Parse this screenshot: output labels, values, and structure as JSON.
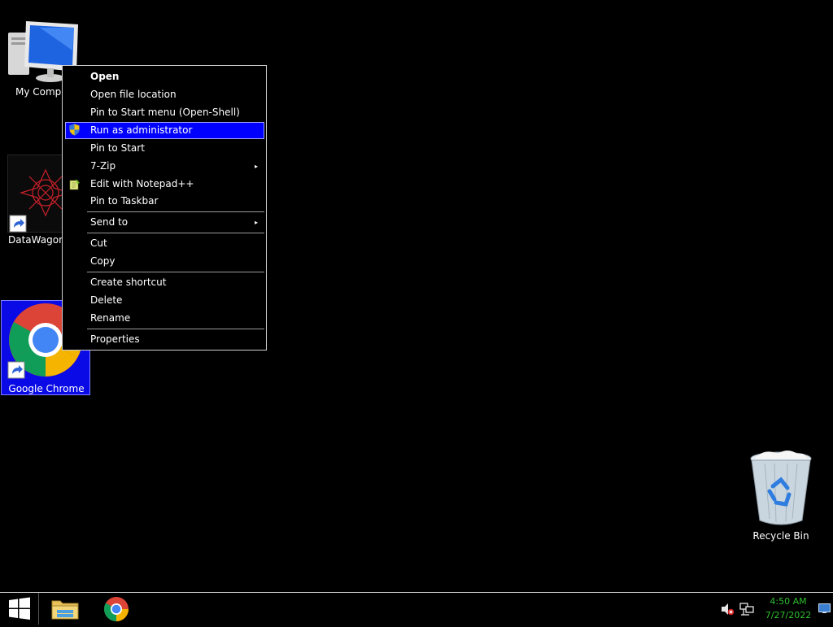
{
  "desktop": {
    "icons": {
      "my_computer": "My Computer",
      "datawagon": "DataWagon.",
      "chrome": "Google Chrome",
      "recycle_bin": "Recycle Bin"
    }
  },
  "context_menu": {
    "items": [
      {
        "label": "Open",
        "bold": true
      },
      {
        "label": "Open file location"
      },
      {
        "label": "Pin to Start menu (Open-Shell)"
      },
      {
        "label": "Run as administrator",
        "icon": "uac-shield-icon",
        "highlighted": true
      },
      {
        "label": "Pin to Start"
      },
      {
        "label": "7-Zip",
        "submenu": true
      },
      {
        "label": "Edit with Notepad++",
        "icon": "notepadpp-icon"
      },
      {
        "label": "Pin to Taskbar"
      },
      {
        "label": "Send to",
        "submenu": true
      },
      {
        "label": "Cut"
      },
      {
        "label": "Copy"
      },
      {
        "label": "Create shortcut"
      },
      {
        "label": "Delete"
      },
      {
        "label": "Rename"
      },
      {
        "label": "Properties"
      }
    ],
    "submenu_arrow": "▸"
  },
  "taskbar": {
    "start_icon": "windows-logo-icon",
    "apps": [
      {
        "name": "File Explorer",
        "icon": "file-explorer-icon"
      },
      {
        "name": "Google Chrome",
        "icon": "chrome-icon"
      }
    ],
    "tray": {
      "volume_icon": "volume-muted-icon",
      "network_icon": "network-icon"
    },
    "clock": {
      "time": "4:50 AM",
      "date": "7/27/2022",
      "color": "#2fbf2f"
    }
  },
  "colors": {
    "background": "#000000",
    "menu_highlight": "#0000ff",
    "selection": "#0a0ae6"
  }
}
